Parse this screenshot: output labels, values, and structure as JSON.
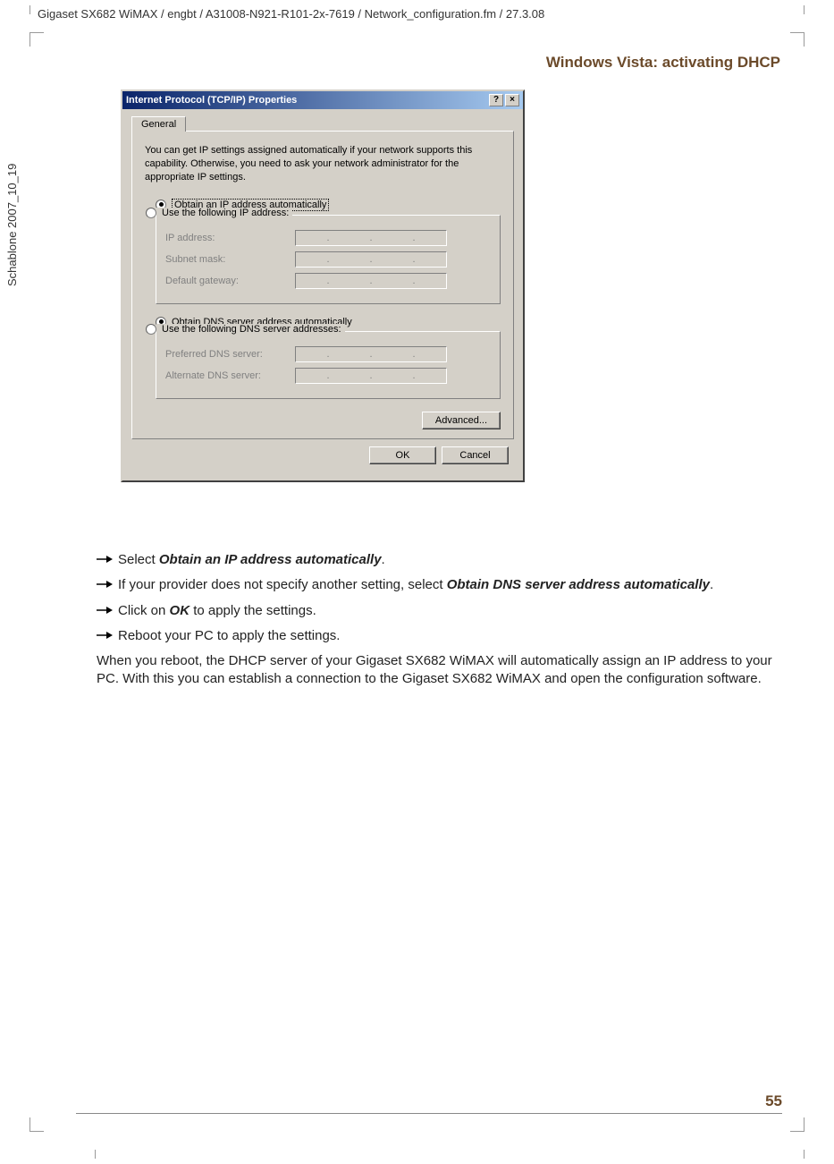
{
  "header_path": "Gigaset SX682 WiMAX / engbt / A31008-N921-R101-2x-7619 / Network_configuration.fm / 27.3.08",
  "vertical_label": "Schablone 2007_10_19",
  "page_title": "Windows Vista: activating DHCP",
  "dialog": {
    "title": "Internet Protocol (TCP/IP) Properties",
    "help_btn": "?",
    "close_btn": "×",
    "tab_general": "General",
    "intro": "You can get IP settings assigned automatically if your network supports this capability. Otherwise, you need to ask your network administrator for the appropriate IP settings.",
    "radio_obtain_ip": "Obtain an IP address automatically",
    "radio_use_ip": "Use the following IP address:",
    "lbl_ip": "IP address:",
    "lbl_subnet": "Subnet mask:",
    "lbl_gateway": "Default gateway:",
    "radio_obtain_dns": "Obtain DNS server address automatically",
    "radio_use_dns": "Use the following DNS server addresses:",
    "lbl_pref_dns": "Preferred DNS server:",
    "lbl_alt_dns": "Alternate DNS server:",
    "advanced": "Advanced...",
    "ok": "OK",
    "cancel": "Cancel"
  },
  "bullets": {
    "b1_pre": "Select ",
    "b1_bold": "Obtain an IP address automatically",
    "b1_post": ".",
    "b2_pre": "If your provider does not specify another setting, select ",
    "b2_bold": "Obtain DNS server address automatically",
    "b2_post": ".",
    "b3_pre": "Click on ",
    "b3_bold": "OK",
    "b3_post": " to apply the settings.",
    "b4": "Reboot your PC to apply the settings."
  },
  "paragraph": "When you reboot, the DHCP server of your Gigaset SX682 WiMAX will automatically assign an IP address to your PC. With this you can establish a connection to the Gigaset SX682 WiMAX and open the configuration software.",
  "page_number": "55"
}
